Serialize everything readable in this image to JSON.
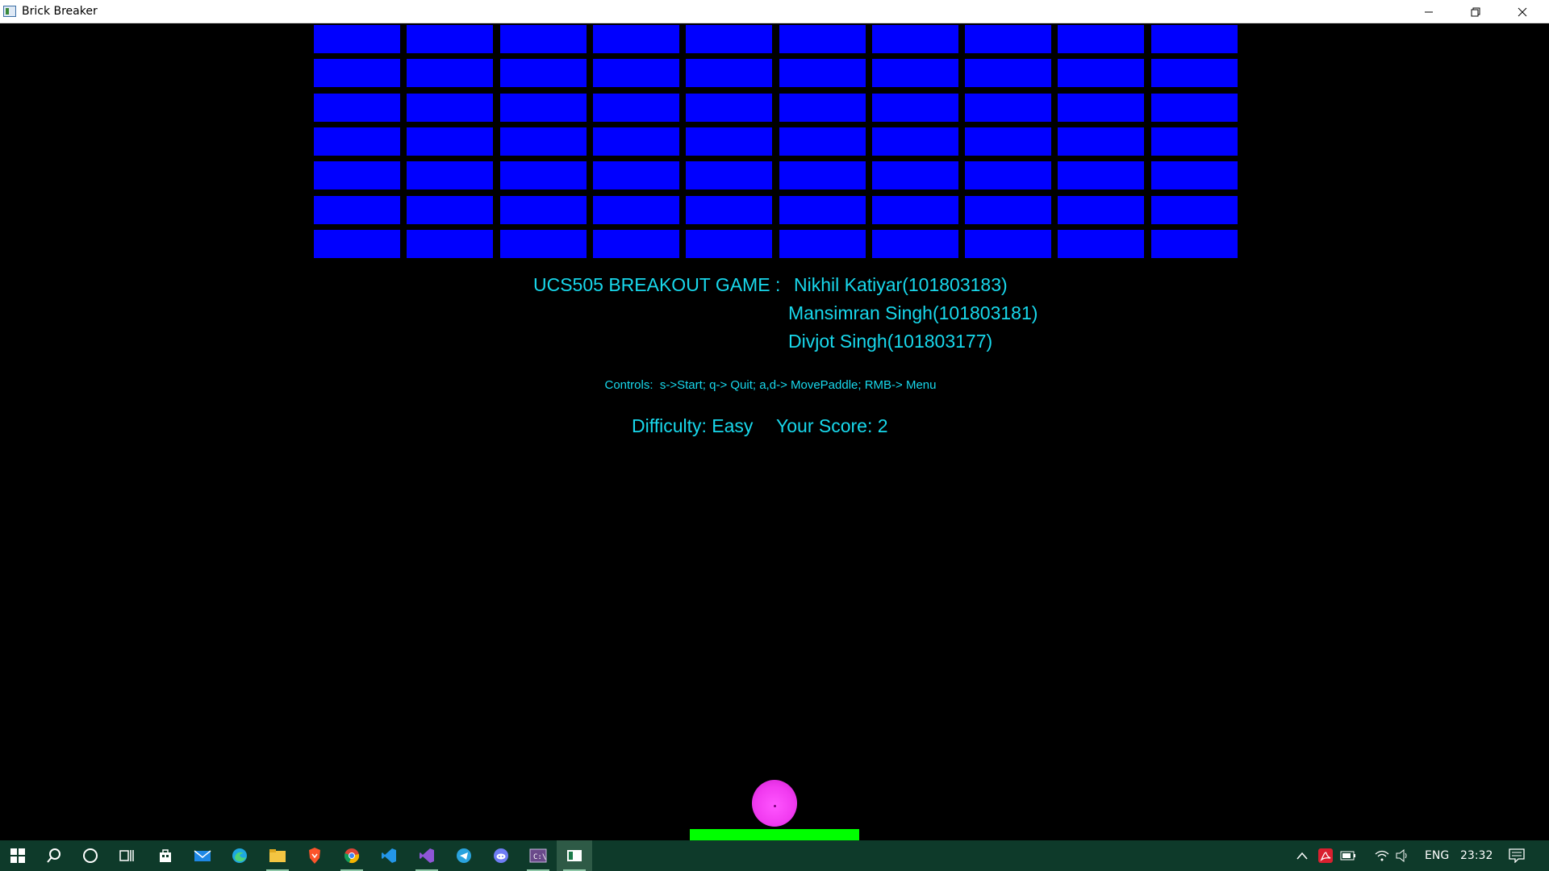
{
  "window": {
    "title": "Brick Breaker",
    "controls": [
      "minimize-icon",
      "restore-icon",
      "close-icon"
    ]
  },
  "game": {
    "bricks": {
      "rows": 7,
      "columns": 10,
      "color": "#0000ff"
    },
    "credits": {
      "label": "UCS505 BREAKOUT GAME  :",
      "authors": [
        "Nikhil Katiyar(101803183)",
        "Mansimran Singh(101803181)",
        "Divjot Singh(101803177)"
      ]
    },
    "controls_text": "Controls:  s->Start; q-> Quit; a,d-> MovePaddle; RMB-> Menu",
    "difficulty_text": "Difficulty: Easy",
    "score_text": "Your Score: 2",
    "difficulty": "Easy",
    "score": 2,
    "colors": {
      "text": "#18d8ec",
      "ball": "#f13bf0",
      "paddle": "#00ff00",
      "background": "#000000"
    }
  },
  "taskbar": {
    "apps": [
      "windows-start-icon",
      "search-icon",
      "cortana-icon",
      "task-view-icon",
      "store-icon",
      "mail-icon",
      "edge-icon",
      "file-explorer-icon",
      "brave-icon",
      "chrome-icon",
      "vscode-icon",
      "visual-studio-icon",
      "telegram-icon",
      "discord-icon",
      "console-icon",
      "brick-breaker-icon"
    ],
    "tray": {
      "language": "ENG",
      "time": "23:32"
    }
  }
}
